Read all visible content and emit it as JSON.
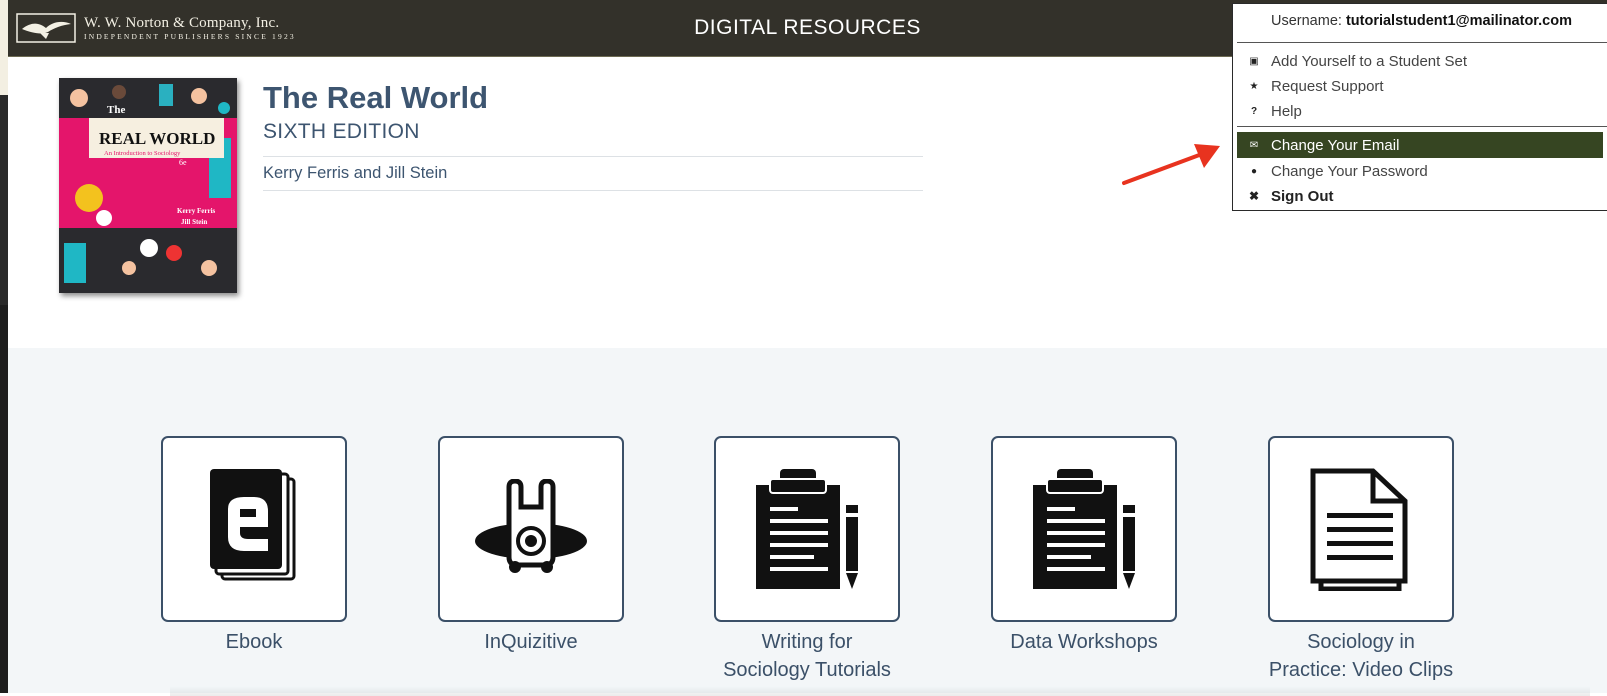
{
  "header": {
    "logo_name": "W. W. Norton & Company, Inc.",
    "logo_tagline": "INDEPENDENT PUBLISHERS SINCE 1923",
    "site_title": "DIGITAL RESOURCES"
  },
  "book": {
    "title": "The Real World",
    "edition": "SIXTH EDITION",
    "authors": "Kerry Ferris and Jill Stein",
    "cover": {
      "small": "The",
      "title": "REAL WORLD",
      "subtitle": "An Introduction to Sociology",
      "edition_mark": "6e",
      "author1": "Kerry Ferris",
      "author2": "Jill Stein"
    }
  },
  "account_menu": {
    "username_label": "Username:",
    "username": "tutorialstudent1@mailinator.com",
    "items": [
      {
        "label": "Add Yourself to a Student Set",
        "icon": "building-icon"
      },
      {
        "label": "Request Support",
        "icon": "star-icon"
      },
      {
        "label": "Help",
        "icon": "question-icon"
      },
      {
        "label": "Change Your Email",
        "icon": "envelope-icon",
        "active": true
      },
      {
        "label": "Change Your Password",
        "icon": "lock-icon"
      },
      {
        "label": "Sign Out",
        "icon": "x-icon"
      }
    ]
  },
  "resources": [
    {
      "label": "Ebook",
      "icon": "ebook-icon"
    },
    {
      "label": "InQuizitive",
      "icon": "inquizitive-icon"
    },
    {
      "label": "Writing for\nSociology Tutorials",
      "icon": "clipboard-pencil-icon"
    },
    {
      "label": "Data Workshops",
      "icon": "clipboard-pencil-icon"
    },
    {
      "label": "Sociology in\nPractice: Video Clips",
      "icon": "document-icon"
    }
  ],
  "colors": {
    "header_bg": "#33312a",
    "accent_text": "#3d5570",
    "menu_active_bg": "#364522",
    "annotation_arrow": "#e8331f"
  }
}
